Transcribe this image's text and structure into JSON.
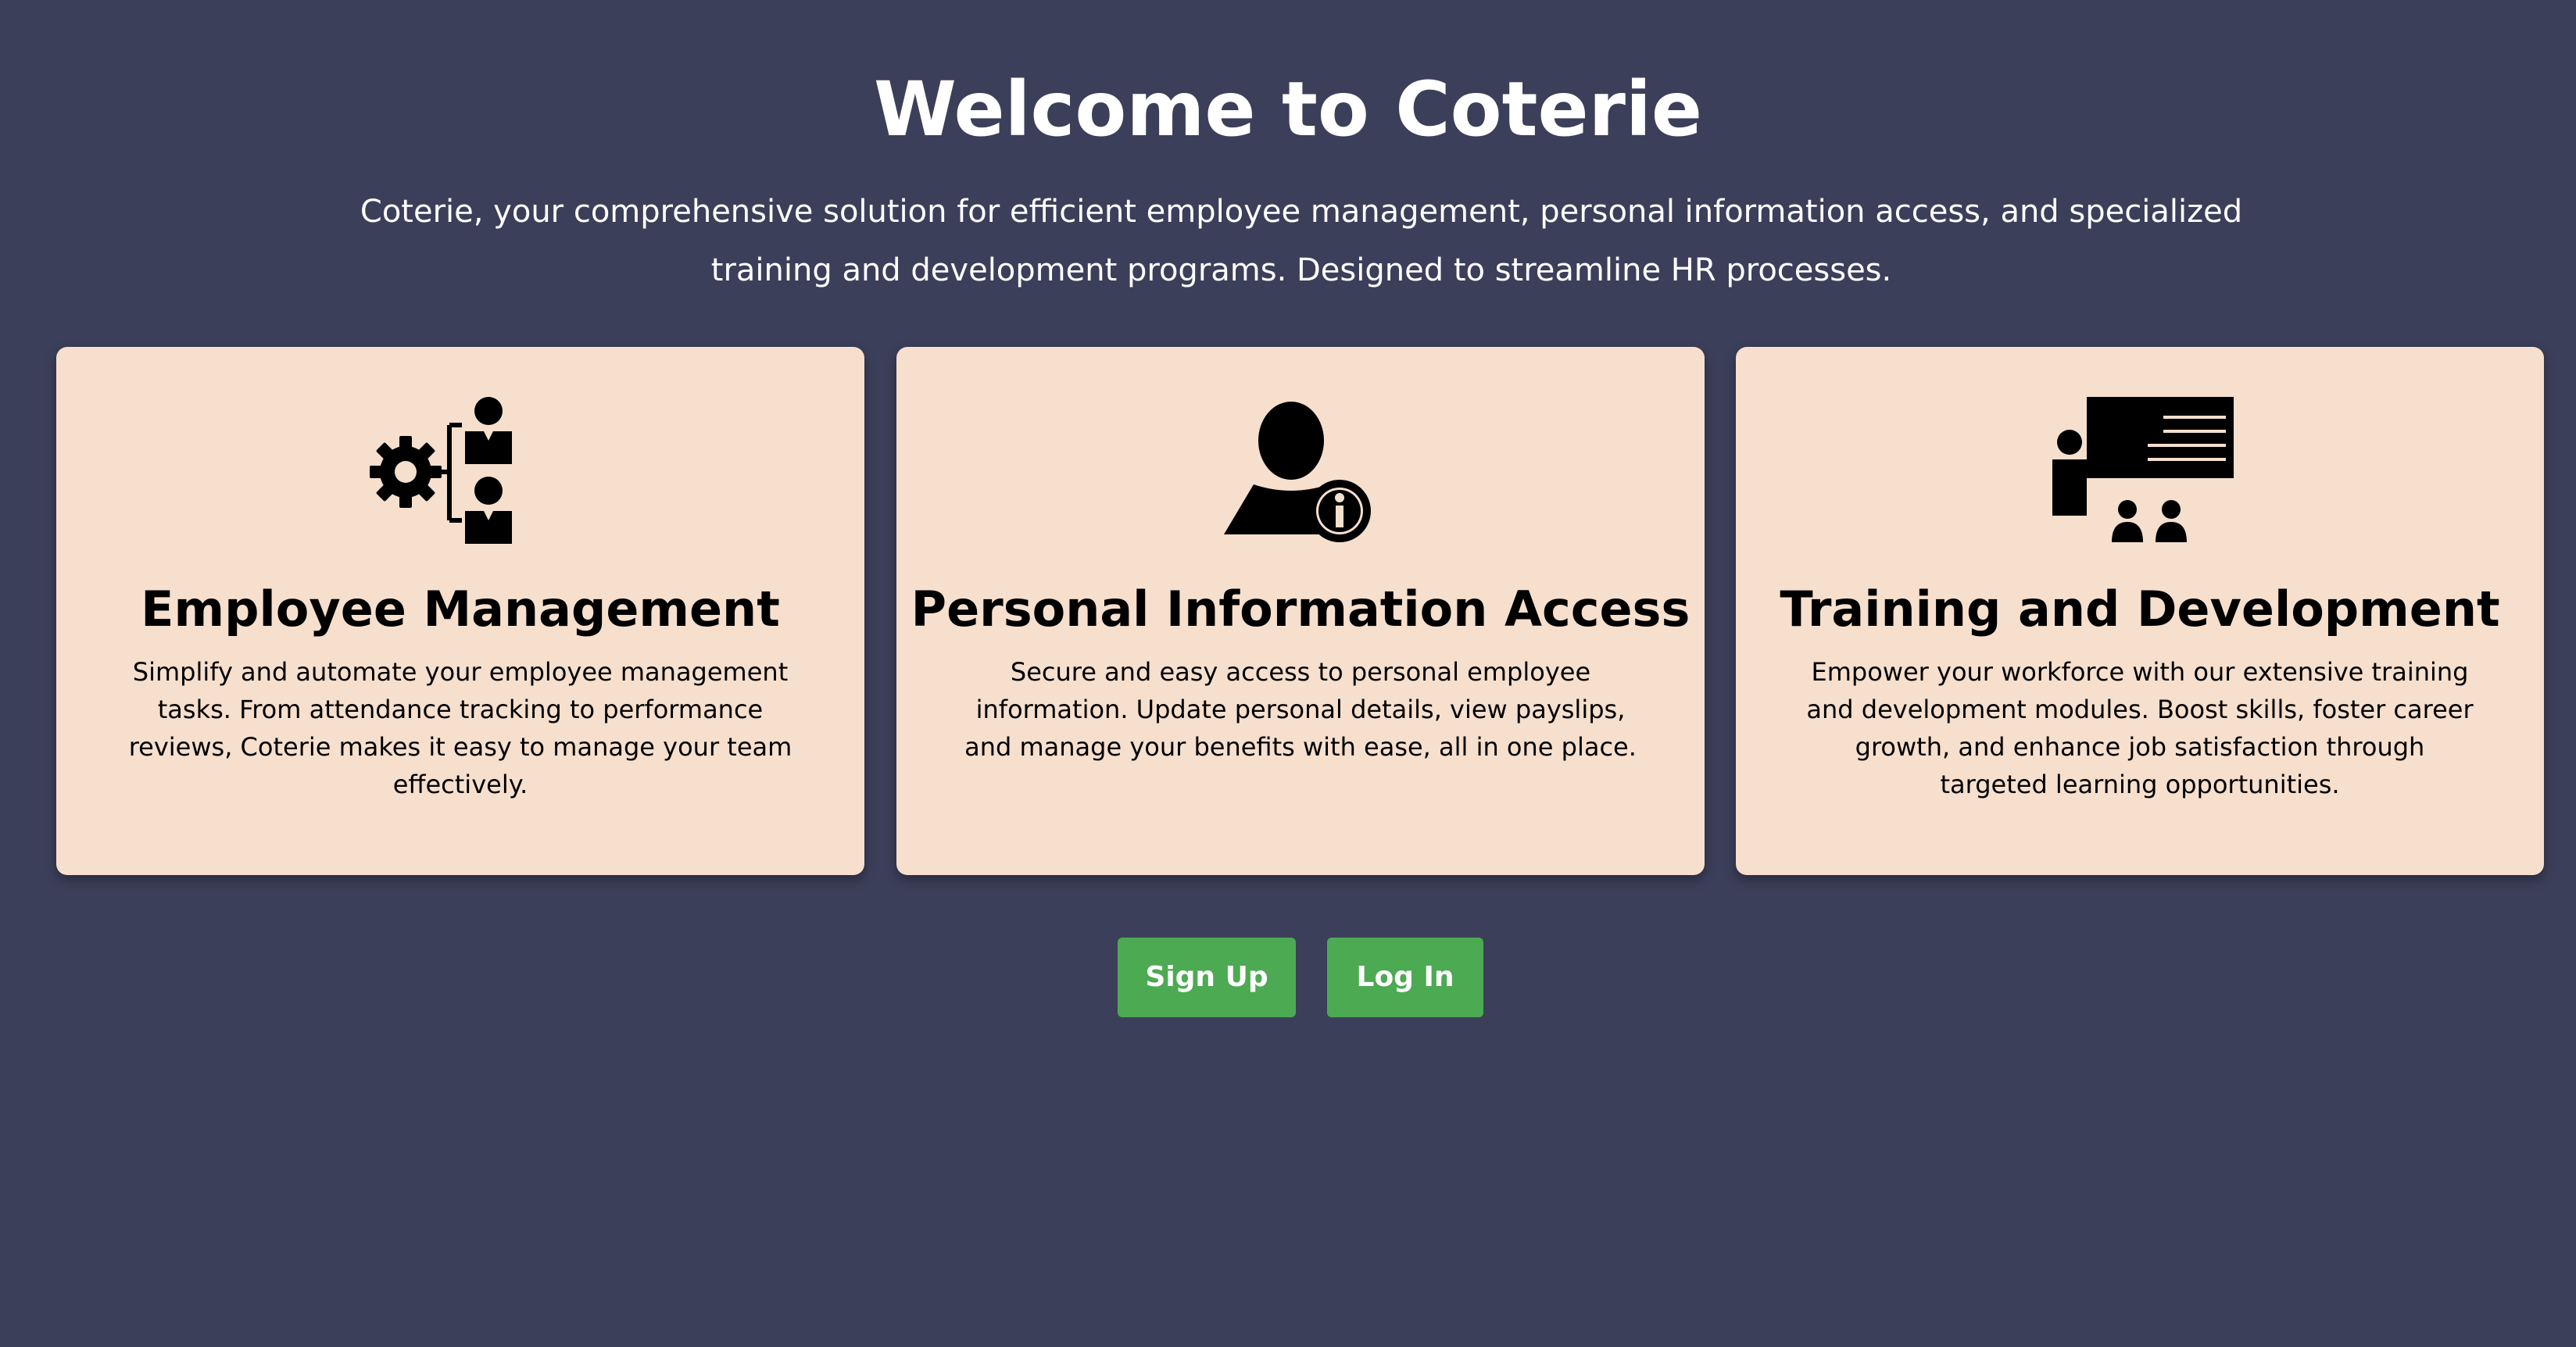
{
  "hero": {
    "title": "Welcome to Coterie",
    "subtitle": "Coterie, your comprehensive solution for efficient employee management, personal information access, and specialized training and development programs. Designed to streamline HR processes."
  },
  "cards": [
    {
      "icon": "employee-management-icon",
      "title": "Employee Management",
      "description": "Simplify and automate your employee management tasks. From attendance tracking to performance reviews, Coterie makes it easy to manage your team effectively."
    },
    {
      "icon": "personal-info-icon",
      "title": "Personal Information Access",
      "description": "Secure and easy access to personal employee information. Update personal details, view payslips, and manage your benefits with ease, all in one place."
    },
    {
      "icon": "training-presentation-icon",
      "title": "Training and Development",
      "description": "Empower your workforce with our extensive training and development modules. Boost skills, foster career growth, and enhance job satisfaction through targeted learning opportunities."
    }
  ],
  "actions": {
    "signup_label": "Sign Up",
    "login_label": "Log In"
  },
  "colors": {
    "background": "#3c3f5a",
    "card": "#f6dfcd",
    "button": "#4caa52"
  }
}
